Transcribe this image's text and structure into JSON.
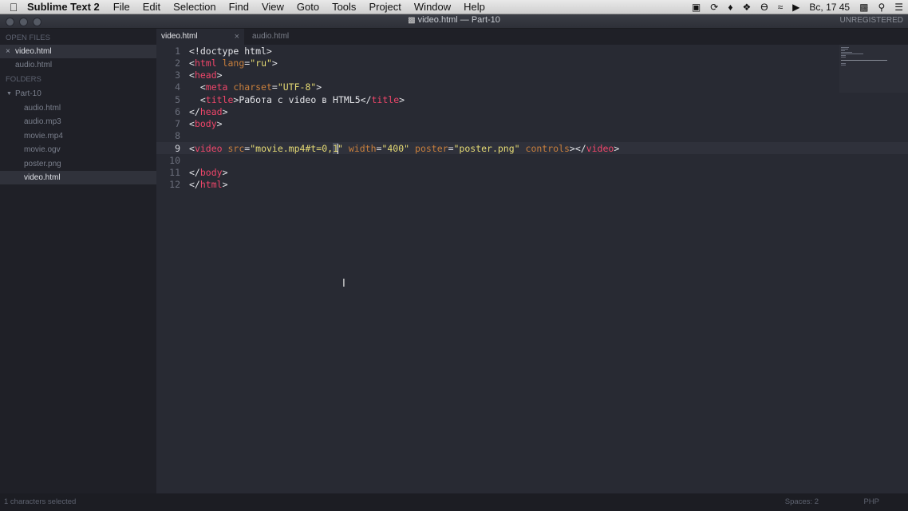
{
  "menubar": {
    "app_name": "Sublime Text 2",
    "items": [
      "File",
      "Edit",
      "Selection",
      "Find",
      "View",
      "Goto",
      "Tools",
      "Project",
      "Window",
      "Help"
    ],
    "clock": "Вс, 17 45"
  },
  "window": {
    "title": "video.html — Part-10",
    "license": "UNREGISTERED"
  },
  "sidebar": {
    "open_files_header": "OPEN FILES",
    "open_files": [
      "video.html",
      "audio.html"
    ],
    "folders_header": "FOLDERS",
    "folder_name": "Part-10",
    "folder_files": [
      "audio.html",
      "audio.mp3",
      "movie.mp4",
      "movie.ogv",
      "poster.png",
      "video.html"
    ]
  },
  "tabs": [
    {
      "label": "video.html",
      "close": "×"
    },
    {
      "label": "audio.html"
    }
  ],
  "editor": {
    "line_numbers": [
      "1",
      "2",
      "3",
      "4",
      "5",
      "6",
      "7",
      "8",
      "9",
      "10",
      "11",
      "12"
    ],
    "current_line": "9",
    "lines": {
      "l1": {
        "t1": "<!doctype html>"
      },
      "l2": {
        "a": "<",
        "b": "html",
        "c": " ",
        "d": "lang",
        "e": "=",
        "f": "\"ru\"",
        "g": ">"
      },
      "l3": {
        "a": "<",
        "b": "head",
        "c": ">"
      },
      "l4": {
        "a": "  <",
        "b": "meta",
        "c": " ",
        "d": "charset",
        "e": "=",
        "f": "\"UTF-8\"",
        "g": ">"
      },
      "l5": {
        "a": "  <",
        "b": "title",
        "c": ">Работа с video в HTML5</",
        "d": "title",
        "e": ">"
      },
      "l6": {
        "a": "</",
        "b": "head",
        "c": ">"
      },
      "l7": {
        "a": "<",
        "b": "body",
        "c": ">"
      },
      "l9": {
        "a": "<",
        "b": "video",
        "c": " ",
        "d": "src",
        "e": "=",
        "f": "\"movie.mp4#t=0,",
        "g": "1",
        "h": "\"",
        "i": " ",
        "j": "width",
        "k": "=",
        "l": "\"400\"",
        "m": " ",
        "n": "poster",
        "o": "=",
        "p": "\"poster.png\"",
        "q": " ",
        "r": "controls",
        "s": "></",
        "t": "video",
        "u": ">"
      },
      "l11": {
        "a": "</",
        "b": "body",
        "c": ">"
      },
      "l12": {
        "a": "</",
        "b": "html",
        "c": ">"
      }
    }
  },
  "statusbar": {
    "selection": "1 characters selected",
    "indent": "Spaces: 2",
    "syntax": "PHP"
  }
}
